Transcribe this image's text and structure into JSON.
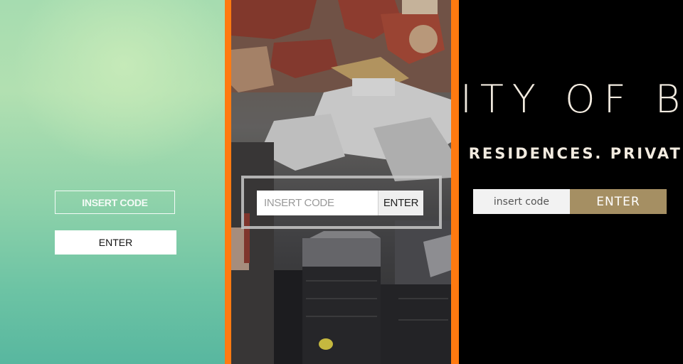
{
  "colors": {
    "mint_top": "#a6dcb0",
    "mint_bottom": "#58b79f",
    "divider_orange": "#ff7a10",
    "gold_button": "#a58f63",
    "cream_text": "#f2ebe0"
  },
  "panel_mint": {
    "code_placeholder": "INSERT CODE",
    "enter_label": "ENTER"
  },
  "panel_city": {
    "code_placeholder": "INSERT CODE",
    "enter_label": "ENTER"
  },
  "panel_black": {
    "headline": "ITY OF B",
    "subline": "RESIDENCES. PRIVATE",
    "subline_prefix": "'",
    "code_placeholder": "insert code",
    "enter_label": "ENTER"
  }
}
